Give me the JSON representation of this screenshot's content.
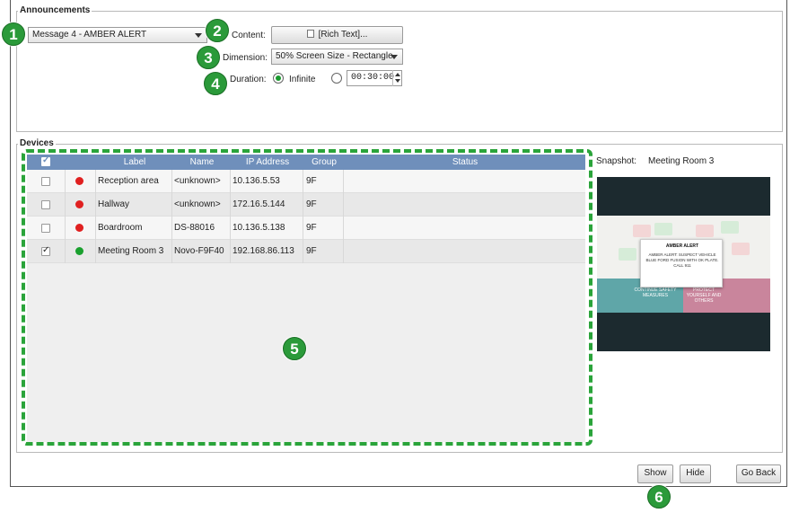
{
  "announcements": {
    "title": "Announcements",
    "message_select": "Message 4 - AMBER ALERT",
    "content_label": "Content:",
    "content_button": "[Rich Text]...",
    "dimension_label": "Dimension:",
    "dimension_select": "50% Screen Size - Rectangle",
    "duration_label": "Duration:",
    "duration_infinite": "Infinite",
    "duration_time": "00:30:00",
    "duration_infinite_selected": true
  },
  "devices": {
    "title": "Devices",
    "columns": [
      "Label",
      "Name",
      "IP Address",
      "Group",
      "Status"
    ],
    "rows": [
      {
        "checked": false,
        "status_color": "#e02020",
        "label": "Reception area",
        "name": "<unknown>",
        "ip": "10.136.5.53",
        "group": "9F"
      },
      {
        "checked": false,
        "status_color": "#e02020",
        "label": "Hallway",
        "name": "<unknown>",
        "ip": "172.16.5.144",
        "group": "9F"
      },
      {
        "checked": false,
        "status_color": "#e02020",
        "label": "Boardroom",
        "name": "DS-88016",
        "ip": "10.136.5.138",
        "group": "9F"
      },
      {
        "checked": true,
        "status_color": "#1aa02e",
        "label": "Meeting Room 3",
        "name": "Novo-F9F40",
        "ip": "192.168.86.113",
        "group": "9F"
      }
    ]
  },
  "snapshot": {
    "label": "Snapshot:",
    "device": "Meeting Room 3",
    "popup_title": "AMBER ALERT",
    "popup_body": "AMBER ALERT: SUSPECT VEHICLE BLUE FORD FUSION WITH OK PLATE. CALL 911",
    "band_left": "CONTINUE SAFETY MEASURES",
    "band_right": "PROTECT YOURSELF AND OTHERS"
  },
  "buttons": {
    "show": "Show",
    "hide": "Hide",
    "go_back": "Go Back"
  },
  "callouts": [
    "1",
    "2",
    "3",
    "4",
    "5",
    "6"
  ],
  "colors": {
    "header_blue": "#6f8fbb",
    "callout_green": "#2b9a3a",
    "dash_green": "#2aa43a",
    "status_red": "#e02020",
    "status_green": "#1aa02e"
  }
}
